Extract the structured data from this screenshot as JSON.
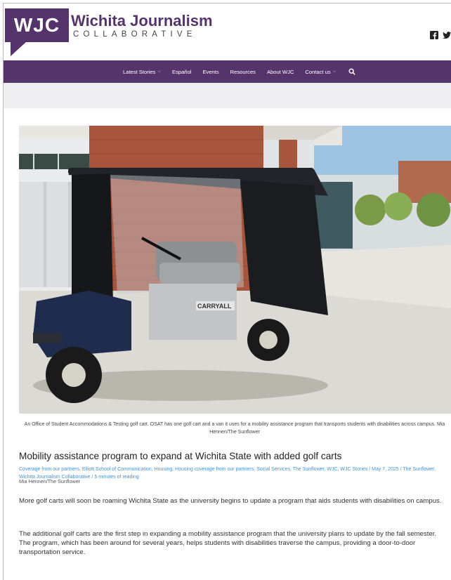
{
  "brand": {
    "logo_text": "WJC",
    "name": "Wichita Journalism",
    "subtitle": "COLLABORATIVE",
    "color": "#55336b"
  },
  "social": [
    {
      "icon": "facebook-icon"
    },
    {
      "icon": "twitter-icon"
    }
  ],
  "nav": {
    "items": [
      {
        "label": "Latest Stories",
        "dropdown": true
      },
      {
        "label": "Español",
        "dropdown": false
      },
      {
        "label": "Events",
        "dropdown": false
      },
      {
        "label": "Resources",
        "dropdown": false
      },
      {
        "label": "About WJC",
        "dropdown": false
      },
      {
        "label": "Contact us",
        "dropdown": true
      }
    ],
    "search_icon": "search-icon"
  },
  "article": {
    "photo_text": "CARRYALL",
    "caption": "An Office of Student Accommodations & Testing golf cart. OSAT has one golf cart and a van it uses for a mobility assistance program that transports students with disabilities across campus. Mia Hennen/The Sunflower",
    "headline": "Mobility assistance program to expand at Wichita State with added golf carts",
    "meta": "Coverage from our partners, Elliott School of Communication, Housing, Housing coverage from our partners, Social Services, The Sunflower, WJC, WJC Stories / May 7, 2025 / The Sunflower, Wichita Journalism Collaborative / 5 minutes of reading",
    "byline": "Mia Hennen/The Sunflower",
    "paragraphs": [
      "More golf carts will soon be roaming Wichita State as the university begins to update a program that aids students with disabilities on campus.",
      "The additional golf carts are the first step in expanding a mobility assistance program that the university plans to update by the fall semester. The program, which has been around for several years, helps students with disabilities traverse the campus, providing a door-to-door transportation service."
    ]
  }
}
